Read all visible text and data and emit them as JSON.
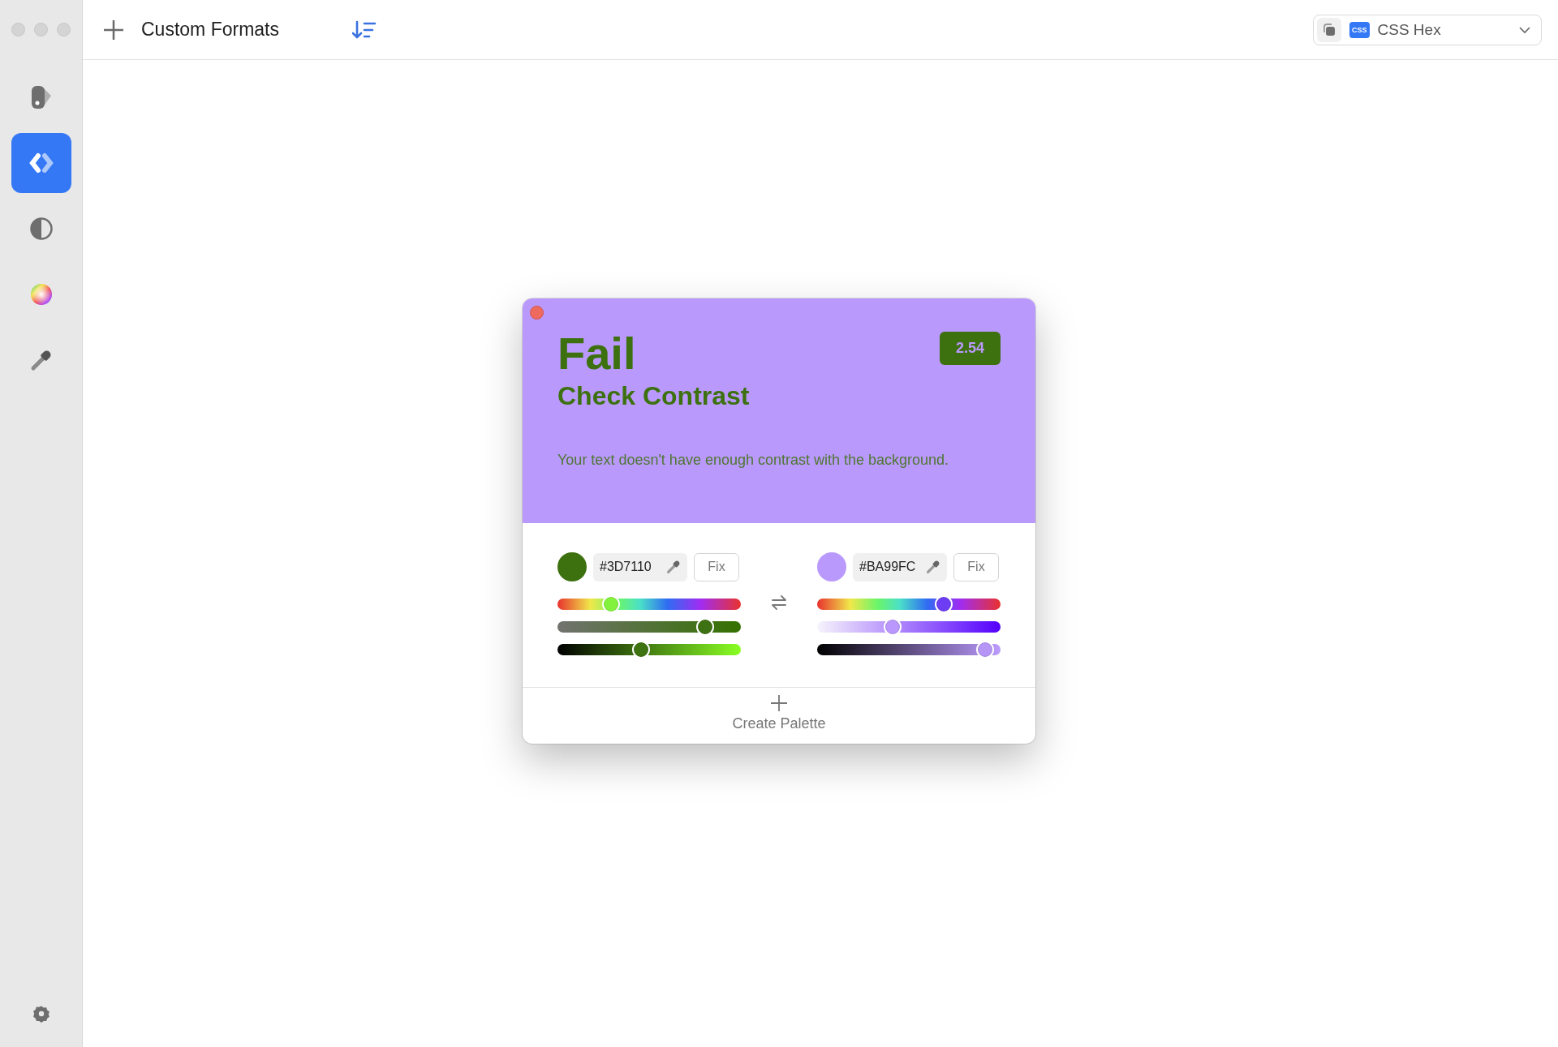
{
  "window": {
    "title": "Custom Formats"
  },
  "sidebar": {
    "items": [
      {
        "kind": "swatches",
        "selected": false
      },
      {
        "kind": "code",
        "selected": true
      },
      {
        "kind": "contrast",
        "selected": false
      },
      {
        "kind": "wheel",
        "selected": false
      },
      {
        "kind": "eyedropper",
        "selected": false
      }
    ]
  },
  "format_picker": {
    "badge": "CSS",
    "value": "CSS Hex"
  },
  "contrast_panel": {
    "verdict": "Fail",
    "title": "Check Contrast",
    "ratio": "2.54",
    "message": "Your text doesn't have enough contrast with the background.",
    "colors": [
      {
        "color": "#3d7110",
        "hex": "#3D7110",
        "fix_label": "Fix",
        "sliders": [
          {
            "kind": "hue",
            "level": 0.27
          },
          {
            "kind": "saturation",
            "level": 0.84
          },
          {
            "kind": "brightness",
            "level": 0.45
          }
        ]
      },
      {
        "color": "#ba99fc",
        "hex": "#BA99FC",
        "fix_label": "Fix",
        "sliders": [
          {
            "kind": "hue",
            "level": 0.71
          },
          {
            "kind": "saturation",
            "level": 0.4
          },
          {
            "kind": "brightness",
            "level": 0.96
          }
        ]
      }
    ],
    "create_label": "Create Palette"
  }
}
